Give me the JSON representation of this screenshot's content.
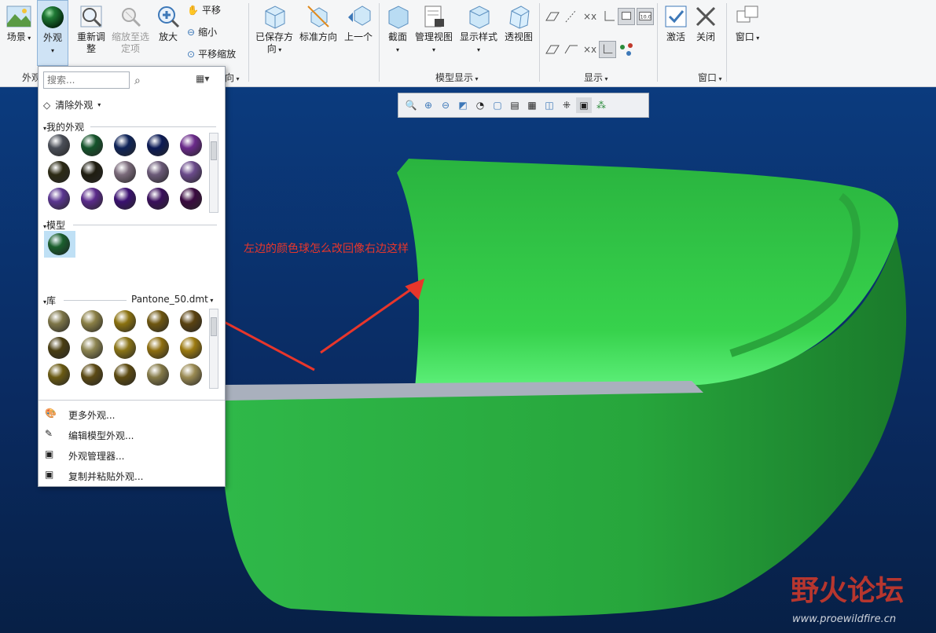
{
  "ribbon": {
    "groups": [
      {
        "id": "scene",
        "label": "场景"
      },
      {
        "id": "appearance",
        "label": "外观"
      },
      {
        "id": "refit",
        "label": "重新调\n整"
      },
      {
        "id": "zoom_sel",
        "label": "缩放至选\n定项"
      },
      {
        "id": "zoom_in",
        "label": "放大"
      },
      {
        "id": "saved_orient",
        "label": "已保存方\n向"
      },
      {
        "id": "std_orient",
        "label": "标准方向"
      },
      {
        "id": "prev",
        "label": "上一个"
      },
      {
        "id": "section",
        "label": "截面"
      },
      {
        "id": "mgr_views",
        "label": "管理视图"
      },
      {
        "id": "display_style",
        "label": "显示样式"
      },
      {
        "id": "perspective",
        "label": "透视图"
      },
      {
        "id": "activate",
        "label": "激活"
      },
      {
        "id": "close",
        "label": "关闭"
      },
      {
        "id": "window",
        "label": "窗口"
      }
    ],
    "pan": "平移",
    "zoom_out": "缩小",
    "pan_zoom": "平移缩放",
    "group_labels": {
      "appearance_group": "外观",
      "orientation_suffix": "向",
      "model_display": "模型显示",
      "show": "显示",
      "window": "窗口"
    }
  },
  "panel": {
    "search_placeholder": "搜索...",
    "clear_appearance": "清除外观",
    "my_appearances": "我的外观",
    "model": "模型",
    "library": "库",
    "library_file": "Pantone_50.dmt",
    "menu": [
      "更多外观...",
      "编辑模型外观...",
      "外观管理器...",
      "复制并粘贴外观..."
    ],
    "my_colors": [
      "#4a4e57",
      "#14532a",
      "#0e2358",
      "#0b1a55",
      "#6a2a8a",
      "#2c2a14",
      "#1f1d10",
      "#7a6a7a",
      "#6b5a78",
      "#6a4a8a",
      "#5a3590",
      "#5a2a8a",
      "#3a1070",
      "#3a0f5c",
      "#3a0a40"
    ],
    "model_colors": [
      "#1b5f2d"
    ],
    "library_colors": [
      "#7d7548",
      "#8a7f45",
      "#8b7210",
      "#6e5610",
      "#5a4210",
      "#4a3e12",
      "#8c8450",
      "#8a7416",
      "#8e6e10",
      "#9c7a10",
      "#6a5a12",
      "#5c4a14",
      "#5c4a10",
      "#857a48",
      "#9a8a52"
    ]
  },
  "annotation": "左边的颜色球怎么改回像右边这样",
  "watermark": {
    "title": "野火论坛",
    "url": "www.proewildfire.cn"
  },
  "colors": {
    "model_green": "#22b23c",
    "annotation_red": "#e8362b"
  }
}
